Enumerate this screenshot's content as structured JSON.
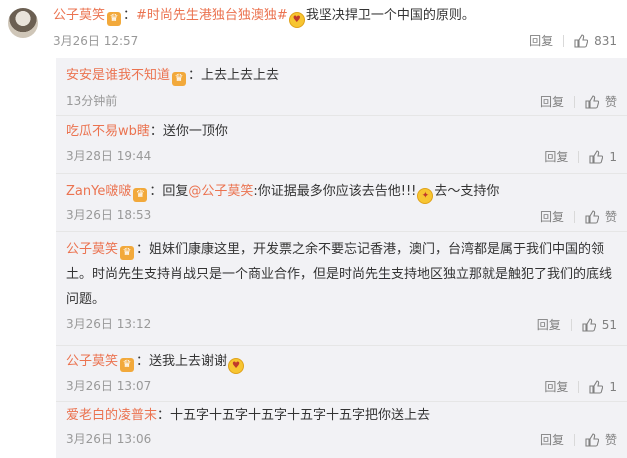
{
  "main": {
    "username": "公子莫笑",
    "topic": "#时尚先生港独台独澳独#",
    "text": "我坚决捍卫一个中国的原则。",
    "time": "3月26日 12:57",
    "reply_label": "回复",
    "like_count": "831"
  },
  "replies": [
    {
      "username": "安安是谁我不知道",
      "text": "：上去上去上去",
      "time": "13分钟前",
      "reply_label": "回复",
      "like_label": "赞"
    },
    {
      "username": "吃瓜不易wb瞎",
      "text": "：送你一顶你",
      "time": "3月28日 19:44",
      "reply_label": "回复",
      "like_label": "1"
    },
    {
      "username": "ZanYe啵啵",
      "reply_prefix": "：回复",
      "mention": "@公子莫笑",
      "text": ":你证据最多你应该去告他!!!",
      "text2": "去～支持你",
      "time": "3月26日 18:53",
      "reply_label": "回复",
      "like_label": "赞"
    },
    {
      "username": "公子莫笑",
      "text": "：姐妹们康康这里，开发票之余不要忘记香港，澳门，台湾都是属于我们中国的领土。时尚先生支持肖战只是一个商业合作，但是时尚先生支持地区独立那就是触犯了我们的底线问题。",
      "time": "3月26日 13:12",
      "reply_label": "回复",
      "like_label": "51"
    },
    {
      "username": "公子莫笑",
      "text": "：送我上去谢谢",
      "time": "3月26日 13:07",
      "reply_label": "回复",
      "like_label": "1"
    },
    {
      "username": "爱老白的凌普末",
      "text": "：十五字十五字十五字十五字十五字把你送上去",
      "time": "3月26日 13:06",
      "reply_label": "回复",
      "like_label": "赞"
    }
  ],
  "colors": {
    "username": "#eb7350",
    "meta": "#999999",
    "reply_bg": "#f2f2f5"
  },
  "icons": {
    "badge": "vip-badge-icon",
    "like": "thumbs-up-icon",
    "emoji": "emoji-icon"
  }
}
